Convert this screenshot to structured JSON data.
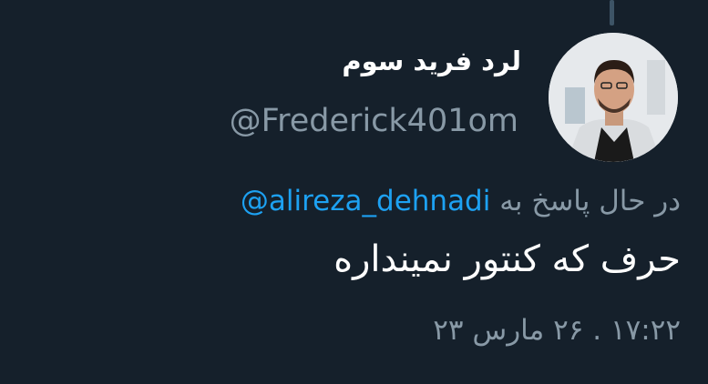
{
  "tweet": {
    "display_name": "لرد فرید سوم",
    "handle": "@Frederick401om",
    "reply_prefix": "در حال پاسخ به",
    "reply_to": "@alireza_dehnadi",
    "text": "حرف که کنتور نمینداره",
    "timestamp": "۱۷:۲۲ . ۲۶ مارس ۲۳"
  },
  "icons": {
    "avatar": "profile-photo"
  },
  "colors": {
    "background": "#15202b",
    "primary_text": "#ffffff",
    "secondary_text": "#8899a6",
    "link": "#1da1f2"
  }
}
